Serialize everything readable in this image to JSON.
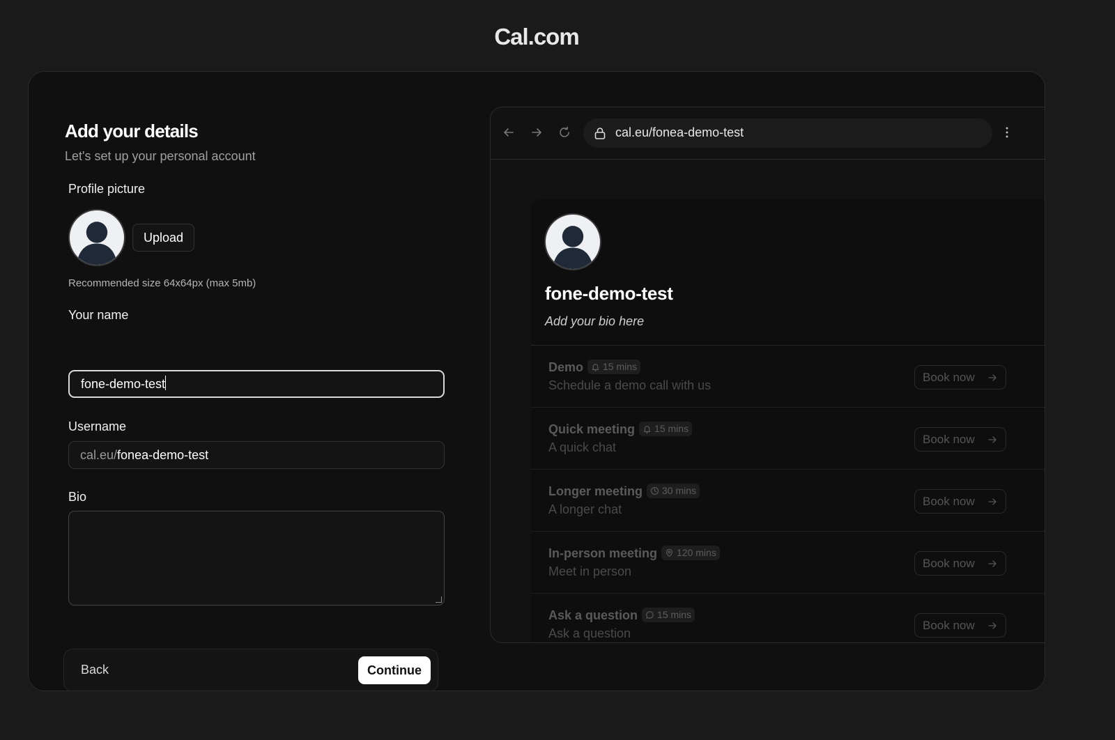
{
  "brand": "Cal.com",
  "form": {
    "title": "Add your details",
    "subtitle": "Let's set up your personal account",
    "profile_picture_label": "Profile picture",
    "upload_label": "Upload",
    "size_hint": "Recommended size 64x64px (max 5mb)",
    "name_label": "Your name",
    "name_value": "fone-demo-test",
    "username_label": "Username",
    "username_prefix": "cal.eu/",
    "username_value": "fonea-demo-test",
    "bio_label": "Bio",
    "bio_value": "",
    "back_label": "Back",
    "continue_label": "Continue"
  },
  "preview": {
    "url": "cal.eu/fonea-demo-test",
    "display_name": "fone-demo-test",
    "bio_placeholder": "Add your bio here",
    "events": [
      {
        "title": "Demo",
        "duration": "15 mins",
        "icon": "bell-icon",
        "description": "Schedule a demo call with us",
        "cta": "Book now"
      },
      {
        "title": "Quick meeting",
        "duration": "15 mins",
        "icon": "bell-icon",
        "description": "A quick chat",
        "cta": "Book now"
      },
      {
        "title": "Longer meeting",
        "duration": "30 mins",
        "icon": "clock-icon",
        "description": "A longer chat",
        "cta": "Book now"
      },
      {
        "title": "In-person meeting",
        "duration": "120 mins",
        "icon": "map-pin-icon",
        "description": "Meet in person",
        "cta": "Book now"
      },
      {
        "title": "Ask a question",
        "duration": "15 mins",
        "icon": "message-icon",
        "description": "Ask a question",
        "cta": "Book now"
      }
    ]
  },
  "colors": {
    "background": "#1a1a1a",
    "card": "#101010",
    "primary_button": "#ffffff",
    "avatar_figure": "#1f2937"
  }
}
